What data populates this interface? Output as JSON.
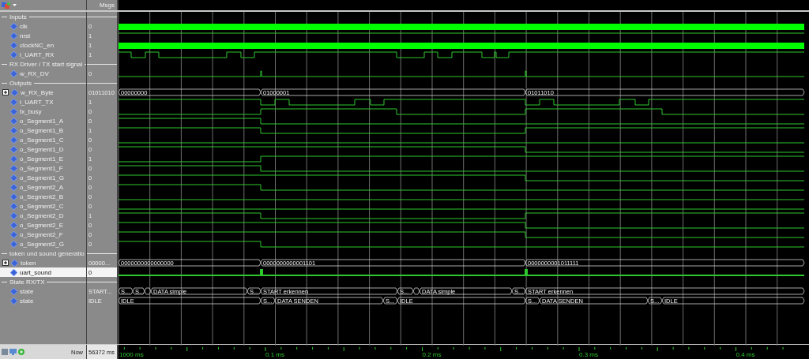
{
  "header": {
    "values_title": "Msgs"
  },
  "groups": [
    {
      "title": "Inputs",
      "signals": [
        {
          "name": "clk",
          "value": "0",
          "kind": "clock",
          "selected": false
        },
        {
          "name": "nrst",
          "value": "1",
          "kind": "bit",
          "selected": false
        },
        {
          "name": "clockNC_en",
          "value": "1",
          "kind": "clock",
          "selected": false
        },
        {
          "name": "i_UART_RX",
          "value": "1",
          "kind": "bit",
          "selected": false
        }
      ]
    },
    {
      "title": "RX Driver / TX start signal",
      "signals": [
        {
          "name": "w_RX_DV",
          "value": "0",
          "kind": "bit",
          "selected": false
        }
      ]
    },
    {
      "title": "Outputs",
      "signals": [
        {
          "name": "w_RX_Byte",
          "value": "01011010",
          "kind": "bus",
          "selected": false,
          "expanded": false,
          "segments": [
            {
              "label": "00000000"
            },
            {
              "label": "01000001"
            },
            {
              "label": "01011010"
            }
          ]
        },
        {
          "name": "i_UART_TX",
          "value": "1",
          "kind": "bit",
          "selected": false
        },
        {
          "name": "tx_busy",
          "value": "0",
          "kind": "bit",
          "selected": false
        },
        {
          "name": "o_Segment1_A",
          "value": "0",
          "kind": "bit",
          "selected": false
        },
        {
          "name": "o_Segment1_B",
          "value": "1",
          "kind": "bit",
          "selected": false
        },
        {
          "name": "o_Segment1_C",
          "value": "0",
          "kind": "bit",
          "selected": false
        },
        {
          "name": "o_Segment1_D",
          "value": "0",
          "kind": "bit",
          "selected": false
        },
        {
          "name": "o_Segment1_E",
          "value": "1",
          "kind": "bit",
          "selected": false
        },
        {
          "name": "o_Segment1_F",
          "value": "0",
          "kind": "bit",
          "selected": false
        },
        {
          "name": "o_Segment1_G",
          "value": "0",
          "kind": "bit",
          "selected": false
        },
        {
          "name": "o_Segment2_A",
          "value": "0",
          "kind": "bit",
          "selected": false
        },
        {
          "name": "o_Segment2_B",
          "value": "0",
          "kind": "bit",
          "selected": false
        },
        {
          "name": "o_Segment2_C",
          "value": "0",
          "kind": "bit",
          "selected": false
        },
        {
          "name": "o_Segment2_D",
          "value": "1",
          "kind": "bit",
          "selected": false
        },
        {
          "name": "o_Segment2_E",
          "value": "0",
          "kind": "bit",
          "selected": false
        },
        {
          "name": "o_Segment2_F",
          "value": "0",
          "kind": "bit",
          "selected": false
        },
        {
          "name": "o_Segment2_G",
          "value": "0",
          "kind": "bit",
          "selected": false
        }
      ]
    },
    {
      "title": "token und sound generatio",
      "signals": [
        {
          "name": "token",
          "value": "00000...",
          "kind": "bus",
          "selected": false,
          "expanded": false,
          "segments": [
            {
              "label": "0000000000000000"
            },
            {
              "label": "0000000000001101"
            },
            {
              "label": "0000000001011111"
            }
          ]
        },
        {
          "name": "uart_sound",
          "value": "0",
          "kind": "bit",
          "selected": true
        }
      ]
    },
    {
      "title": "State RX/TX",
      "signals": [
        {
          "name": "state",
          "value": "START...",
          "kind": "bus",
          "selected": false,
          "segments": [
            {
              "label": "S..."
            },
            {
              "label": "S..."
            },
            {
              "label": "DATA simple"
            },
            {
              "label": "S..."
            },
            {
              "label": "START erkennen"
            },
            {
              "label": "S..."
            },
            {
              "label": "DATA simple"
            },
            {
              "label": "S..."
            },
            {
              "label": "START erkennen"
            }
          ]
        },
        {
          "name": "state",
          "value": "IDLE",
          "kind": "bus",
          "selected": false,
          "segments": [
            {
              "label": "IDLE"
            },
            {
              "label": "S..."
            },
            {
              "label": "DATA SENDEN"
            },
            {
              "label": "S..."
            },
            {
              "label": "IDLE"
            },
            {
              "label": "S..."
            },
            {
              "label": "DATA SENDEN"
            },
            {
              "label": "S..."
            },
            {
              "label": "IDLE"
            }
          ]
        }
      ]
    }
  ],
  "cursor": {
    "label": "Now",
    "value": "56372 ms"
  },
  "time_axis": {
    "labels": [
      "1000 ms",
      "0.1 ms",
      "0.2 ms",
      "0.3 ms",
      "0.4 ms"
    ]
  }
}
